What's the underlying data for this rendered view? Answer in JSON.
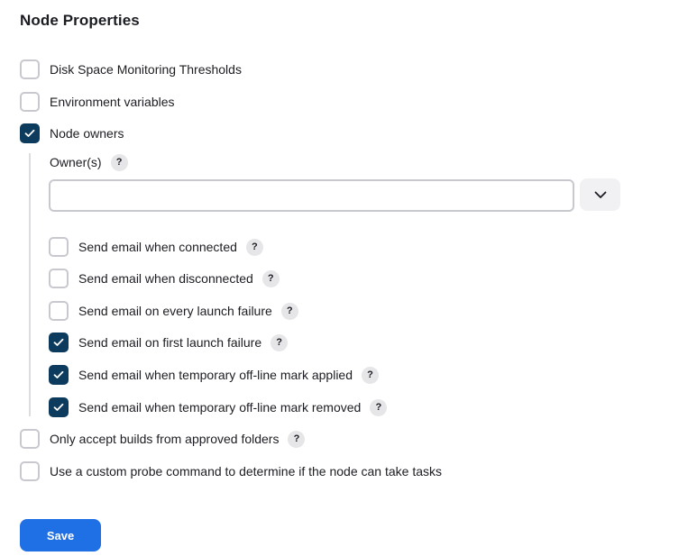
{
  "section": {
    "title": "Node Properties"
  },
  "properties": {
    "disk_space": {
      "label": "Disk Space Monitoring Thresholds",
      "checked": false
    },
    "env_vars": {
      "label": "Environment variables",
      "checked": false
    },
    "node_owners": {
      "label": "Node owners",
      "checked": true
    },
    "approved_folders": {
      "label": "Only accept builds from approved folders",
      "checked": false
    },
    "custom_probe": {
      "label": "Use a custom probe command to determine if the node can take tasks",
      "checked": false
    }
  },
  "owners": {
    "label": "Owner(s)",
    "help": "?",
    "input_value": "",
    "options": [
      {
        "label": "Send email when connected",
        "checked": false,
        "help": "?"
      },
      {
        "label": "Send email when disconnected",
        "checked": false,
        "help": "?"
      },
      {
        "label": "Send email on every launch failure",
        "checked": false,
        "help": "?"
      },
      {
        "label": "Send email on first launch failure",
        "checked": true,
        "help": "?"
      },
      {
        "label": "Send email when temporary off-line mark applied",
        "checked": true,
        "help": "?"
      },
      {
        "label": "Send email when temporary off-line mark removed",
        "checked": true,
        "help": "?"
      }
    ]
  },
  "approved_folders_help": "?",
  "actions": {
    "save_label": "Save"
  },
  "icons": {
    "checkmark": "check-icon",
    "dropdown": "chevron-down-icon",
    "help": "help-icon"
  },
  "colors": {
    "checkbox_checked": "#0c3b5e",
    "save_button": "#1f6fe5",
    "help_badge": "#e6e6e9"
  }
}
